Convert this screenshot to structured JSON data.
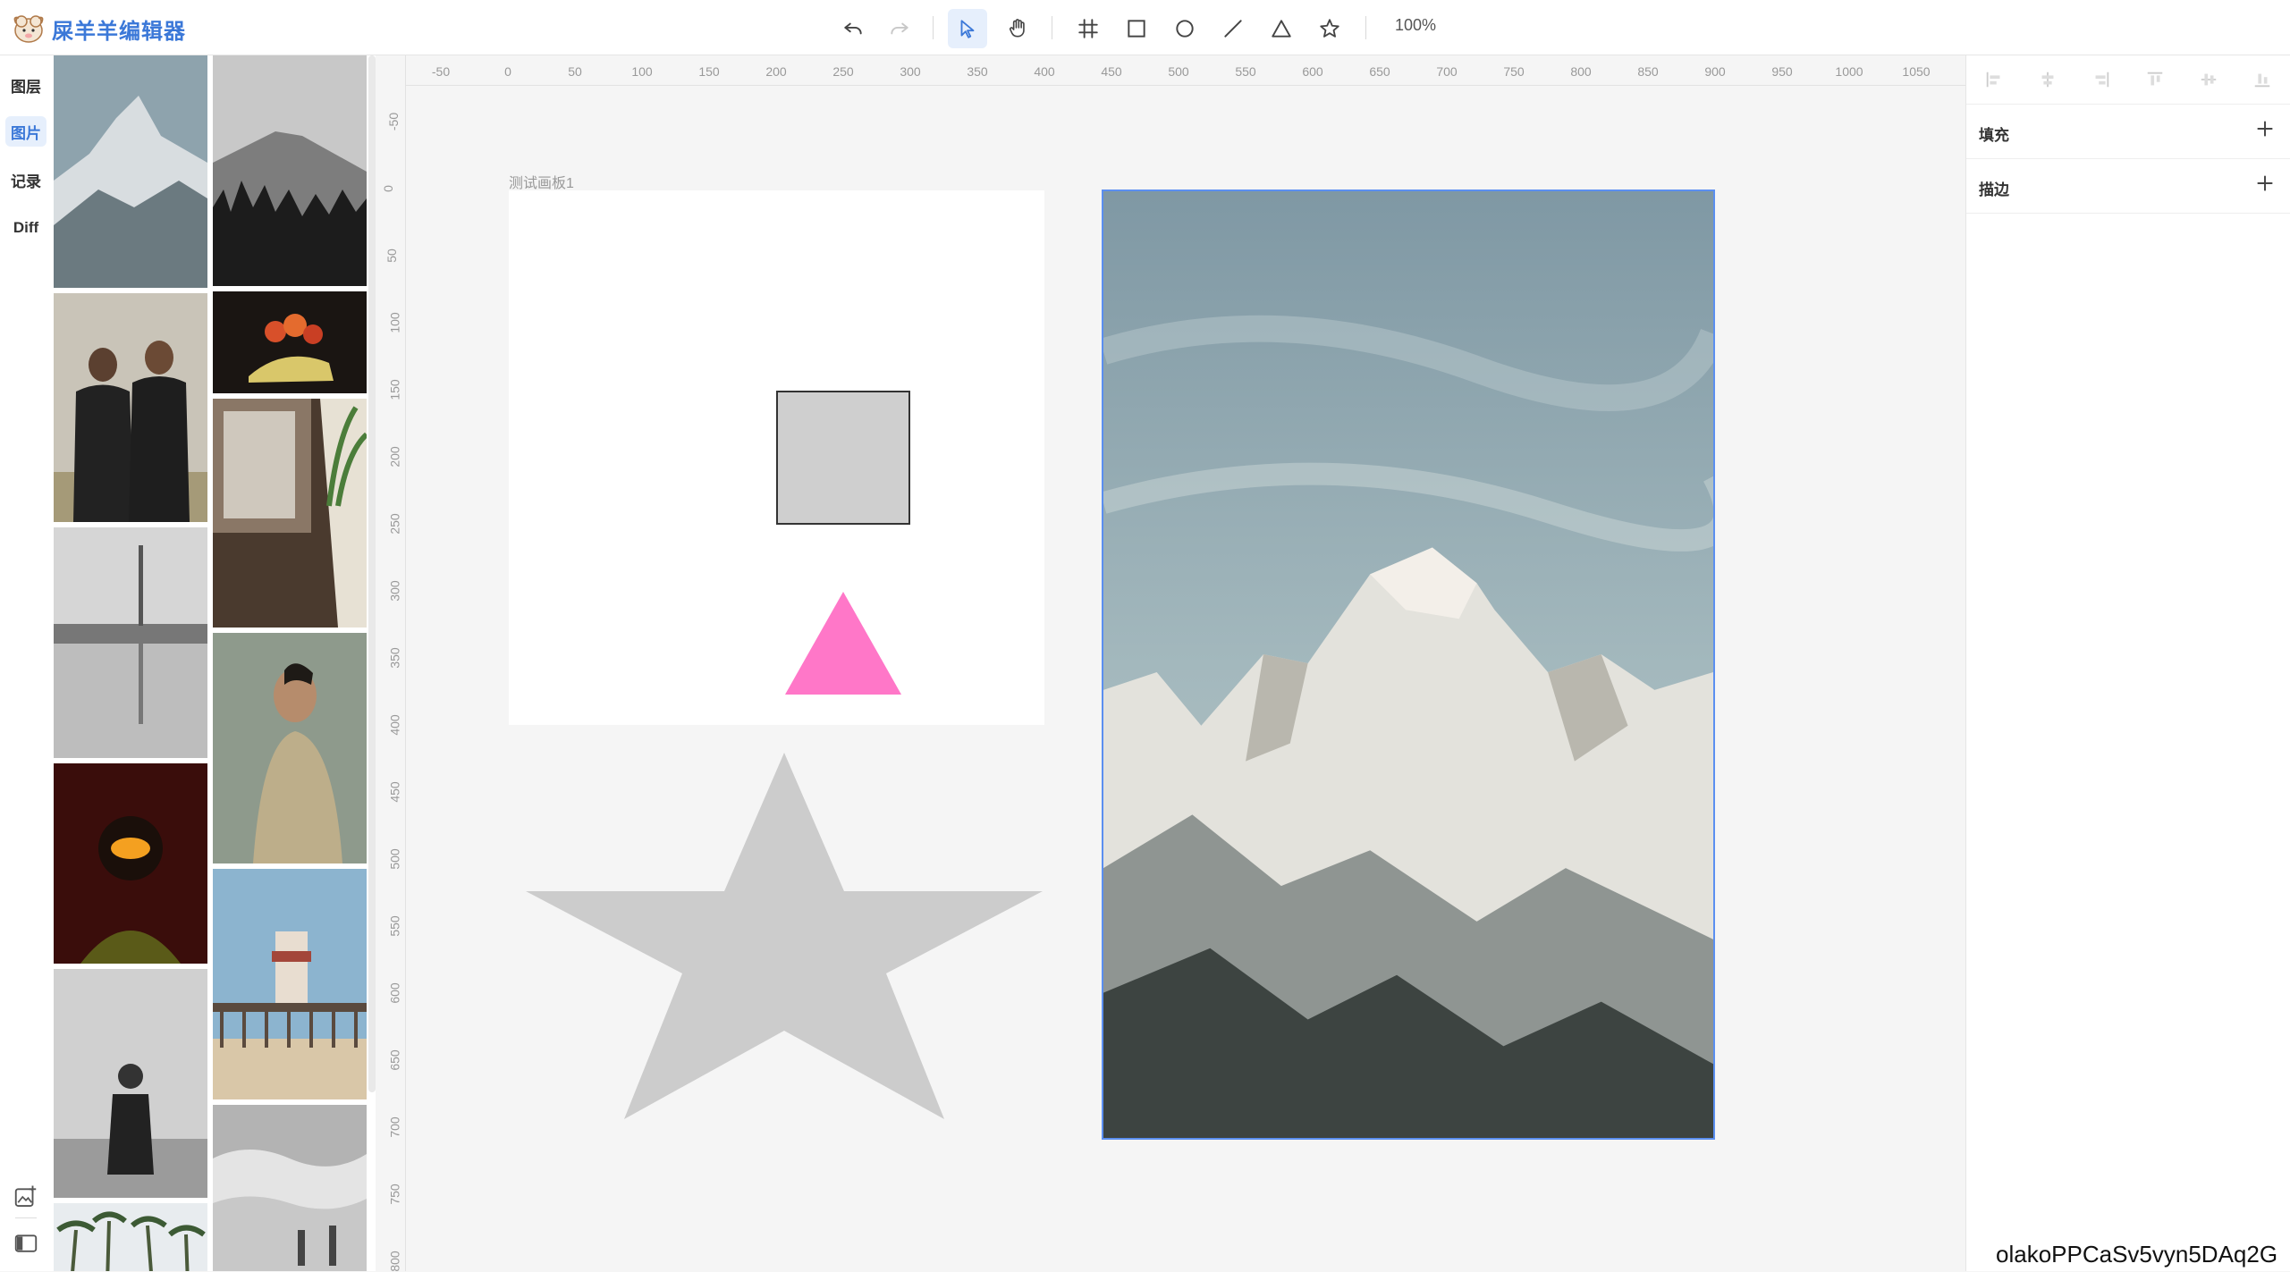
{
  "app": {
    "title": "屎羊羊编辑器"
  },
  "toolbar": {
    "zoom": "100%",
    "tools": [
      "undo-icon",
      "redo-icon",
      "select-icon",
      "hand-icon",
      "frame-icon",
      "rectangle-icon",
      "ellipse-icon",
      "line-icon",
      "triangle-icon",
      "star-icon"
    ],
    "active_tool": "select-icon"
  },
  "rail": {
    "items": [
      {
        "label": "图层"
      },
      {
        "label": "图片"
      },
      {
        "label": "记录"
      },
      {
        "label": "Diff"
      }
    ],
    "active": "图片",
    "bottom_icons": [
      "image-upload-icon",
      "panel-toggle-icon"
    ]
  },
  "rulers": {
    "horizontal": [
      "-50",
      "0",
      "50",
      "100",
      "150",
      "200",
      "250",
      "300",
      "350",
      "400",
      "450",
      "500",
      "550",
      "600",
      "650",
      "700",
      "750",
      "800",
      "850",
      "900",
      "950",
      "1000",
      "1050"
    ],
    "vertical": [
      "-50",
      "0",
      "50",
      "100",
      "150",
      "200",
      "250",
      "300",
      "350",
      "400",
      "450",
      "500",
      "550",
      "600",
      "650",
      "700",
      "750",
      "800"
    ]
  },
  "canvas": {
    "artboard_label": "测试画板1",
    "colors": {
      "rect_fill": "#cfcfcf",
      "triangle_fill": "#ff77c8",
      "star_fill": "#cccccc",
      "selection": "#5b8ff0"
    }
  },
  "right_panel": {
    "align_icons": [
      "align-left-icon",
      "align-center-h-icon",
      "align-right-icon",
      "align-top-icon",
      "align-center-v-icon",
      "align-bottom-icon"
    ],
    "fill_label": "填充",
    "stroke_label": "描边"
  },
  "watermark": "olakoPPCaSv5vyn5DAq2G"
}
